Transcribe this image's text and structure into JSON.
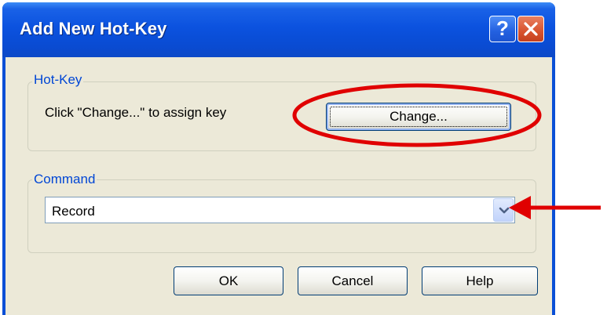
{
  "window": {
    "title": "Add New Hot-Key",
    "help_button_label": "?",
    "close_icon": "close-x-icon"
  },
  "hotkey_group": {
    "label": "Hot-Key",
    "instruction": "Click \"Change...\" to assign key",
    "change_button_label": "Change..."
  },
  "command_group": {
    "label": "Command",
    "selected_value": "Record",
    "dropdown_icon": "chevron-down-icon"
  },
  "buttons": {
    "ok_label": "OK",
    "cancel_label": "Cancel",
    "help_label": "Help"
  },
  "annotations": {
    "highlight_color": "#e00000",
    "circle_target": "change-button",
    "arrow_target": "command-dropdown"
  },
  "colors": {
    "titlebar": "#0b52df",
    "dialog_background": "#ece9d8",
    "group_label": "#0046d5",
    "close_button": "#d8532e"
  }
}
